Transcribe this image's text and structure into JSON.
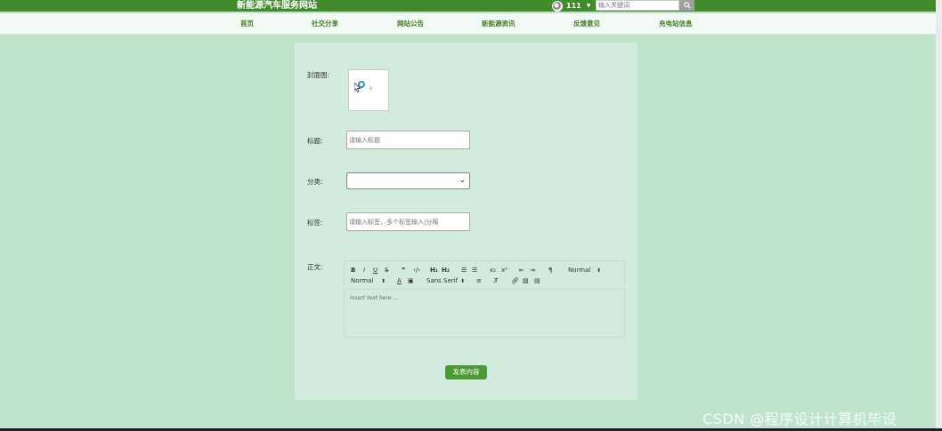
{
  "header": {
    "site_title": "新能源汽车服务网站",
    "username": "111",
    "search_placeholder": "输入关键词"
  },
  "nav": {
    "items": [
      {
        "label": "首页"
      },
      {
        "label": "社交分享"
      },
      {
        "label": "网站公告"
      },
      {
        "label": "新能源资讯"
      },
      {
        "label": "反馈意见"
      },
      {
        "label": "充电站信息"
      }
    ]
  },
  "form": {
    "cover_label": "封面图:",
    "title_label": "标题:",
    "title_placeholder": "请输入标题",
    "category_label": "分类:",
    "category_value": "",
    "tags_label": "标签:",
    "tags_placeholder": "请输入标签，多个标签输入|分隔",
    "body_label": "正文:",
    "editor": {
      "header_select": "Normal",
      "size_select": "Normal",
      "font_select": "Sans Serif",
      "placeholder": "Insert text here ..."
    },
    "submit_label": "发表内容"
  },
  "watermark": "CSDN @程序设计计算机毕设"
}
